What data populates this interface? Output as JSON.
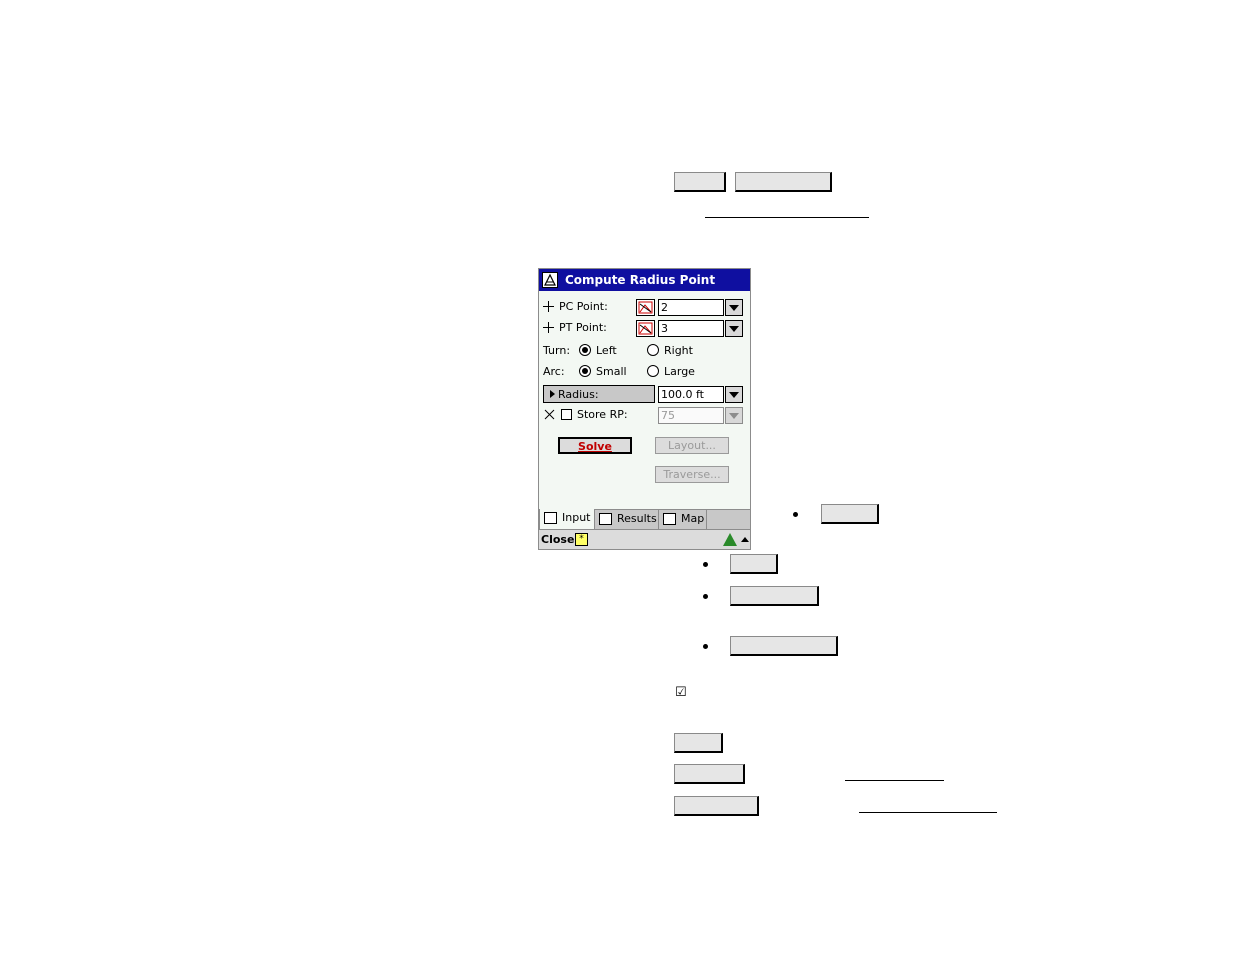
{
  "window": {
    "title": "Compute Radius Point",
    "pc_point": {
      "label": "PC Point:",
      "value": "2"
    },
    "pt_point": {
      "label": "PT Point:",
      "value": "3"
    },
    "turn": {
      "label": "Turn:",
      "options": [
        "Left",
        "Right"
      ],
      "selected": "Left"
    },
    "arc": {
      "label": "Arc:",
      "options": [
        "Small",
        "Large"
      ],
      "selected": "Small"
    },
    "radius": {
      "label": "Radius:",
      "value": "100.0 ft"
    },
    "store_rp": {
      "label": "Store RP:",
      "value": "75",
      "checked": false
    },
    "buttons": {
      "solve": "Solve",
      "layout": "Layout...",
      "traverse": "Traverse..."
    },
    "tabs": [
      {
        "label": "Input",
        "icon": "input-tab-icon",
        "active": true
      },
      {
        "label": "Results",
        "icon": "results-tab-icon",
        "active": false
      },
      {
        "label": "Map",
        "icon": "map-tab-icon",
        "active": false
      }
    ],
    "menubar": {
      "close": "Close"
    }
  },
  "page": {
    "checkbox_glyph": "☑",
    "colors": {
      "titlebar": "#0f0fa0",
      "solve_text": "#c00000",
      "window_bg": "#f3f8f3"
    }
  }
}
